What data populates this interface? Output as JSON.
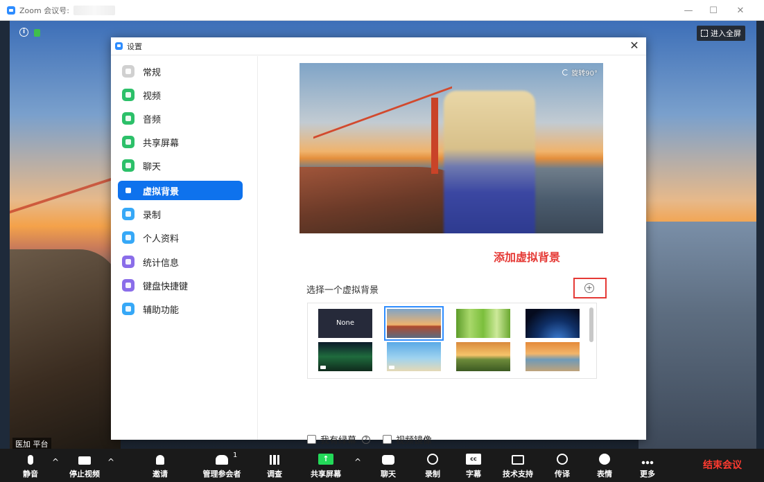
{
  "window": {
    "title": "Zoom 会议号:",
    "controls": [
      "—",
      "☐",
      "✕"
    ]
  },
  "meeting": {
    "fullscreen_label": "进入全屏",
    "participant_name": "医加 平台"
  },
  "settings": {
    "title": "设置",
    "close": "✕",
    "nav": [
      {
        "label": "常规",
        "icon": "gear-icon",
        "color": "#d0d0d0"
      },
      {
        "label": "视频",
        "icon": "video-icon",
        "color": "#2cc069"
      },
      {
        "label": "音频",
        "icon": "headphone-icon",
        "color": "#2cc069"
      },
      {
        "label": "共享屏幕",
        "icon": "share-screen-icon",
        "color": "#2cc069"
      },
      {
        "label": "聊天",
        "icon": "chat-icon",
        "color": "#2cc069"
      },
      {
        "label": "虚拟背景",
        "icon": "virtual-background-icon",
        "color": "#0e72ed"
      },
      {
        "label": "录制",
        "icon": "record-icon",
        "color": "#36a8f7"
      },
      {
        "label": "个人资料",
        "icon": "profile-icon",
        "color": "#36a8f7"
      },
      {
        "label": "统计信息",
        "icon": "statistics-icon",
        "color": "#8a6de9"
      },
      {
        "label": "键盘快捷键",
        "icon": "keyboard-icon",
        "color": "#8a6de9"
      },
      {
        "label": "辅助功能",
        "icon": "accessibility-icon",
        "color": "#36a8f7"
      }
    ],
    "active_index": 5,
    "rotate_label": "旋转90°",
    "annotation": "添加虚拟背景",
    "choose_label": "选择一个虚拟背景",
    "add_icon": "+",
    "backgrounds": [
      {
        "label": "None"
      },
      {
        "label": ""
      },
      {
        "label": ""
      },
      {
        "label": ""
      },
      {
        "label": ""
      },
      {
        "label": ""
      },
      {
        "label": ""
      },
      {
        "label": ""
      }
    ],
    "selected_background": 1,
    "green_screen_label": "我有绿幕",
    "mirror_label": "视频镜像",
    "help_icon": "?"
  },
  "toolbar": {
    "items": [
      {
        "label": "静音",
        "icon": "microphone-icon"
      },
      {
        "label": "停止视频",
        "icon": "video-camera-icon"
      },
      {
        "label": "邀请",
        "icon": "invite-icon"
      },
      {
        "label": "管理参会者",
        "icon": "participants-icon",
        "count": "1"
      },
      {
        "label": "调查",
        "icon": "poll-icon"
      },
      {
        "label": "共享屏幕",
        "icon": "share-screen-icon"
      },
      {
        "label": "聊天",
        "icon": "chat-icon"
      },
      {
        "label": "录制",
        "icon": "record-icon"
      },
      {
        "label": "字幕",
        "icon": "caption-icon",
        "glyph": "cc"
      },
      {
        "label": "技术支持",
        "icon": "tech-support-icon"
      },
      {
        "label": "传译",
        "icon": "interpretation-icon"
      },
      {
        "label": "表情",
        "icon": "reaction-icon"
      },
      {
        "label": "更多",
        "icon": "more-icon"
      }
    ],
    "end_label": "结束会议",
    "end_color": "#ff3b30",
    "share_color": "#23d959"
  }
}
